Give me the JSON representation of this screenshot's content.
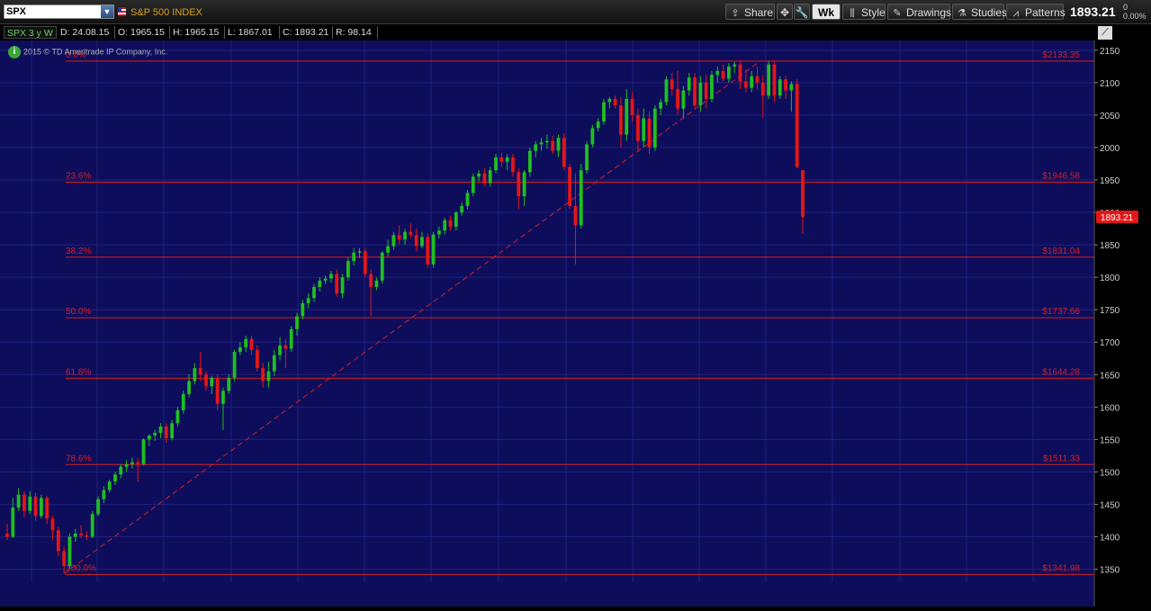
{
  "header": {
    "symbol": "SPX",
    "description": "S&P 500 INDEX",
    "last_price": "1893.21",
    "change_abs": "0",
    "change_pct": "0.00%",
    "buttons": {
      "share": "Share",
      "wk": "Wk",
      "style": "Style",
      "drawings": "Drawings",
      "studies": "Studies",
      "patterns": "Patterns"
    }
  },
  "infobar": {
    "chart_symbol": "SPX 3 y W",
    "date": "D: 24.08.15",
    "open": "O: 1965.15",
    "high": "H: 1965.15",
    "low": "L: 1867.01",
    "close": "C: 1893.21",
    "range": "R: 98.14"
  },
  "copyright": "2015 © TD Ameritrade IP Company, Inc.",
  "colors": {
    "background": "#0d0d5c",
    "up": "#1fbf1f",
    "down": "#e51616",
    "fib_line": "#d42020",
    "grid": "#202080",
    "price_marker": "#e51616"
  },
  "chart_data": {
    "type": "candlestick",
    "symbol": "SPX",
    "interval": "weekly",
    "span": "3 years",
    "ylim": [
      1330,
      2165
    ],
    "y_ticks": [
      1350,
      1400,
      1450,
      1500,
      1550,
      1600,
      1650,
      1700,
      1750,
      1800,
      1850,
      1900,
      1950,
      2000,
      2050,
      2100,
      2150
    ],
    "last_price_label": "1893.21",
    "fibonacci": [
      {
        "pct": "0.0%",
        "price": 2133.35,
        "price_label": "$2133.35"
      },
      {
        "pct": "23.6%",
        "price": 1946.58,
        "price_label": "$1946.58"
      },
      {
        "pct": "38.2%",
        "price": 1831.04,
        "price_label": "$1831.04"
      },
      {
        "pct": "50.0%",
        "price": 1737.66,
        "price_label": "$1737.66"
      },
      {
        "pct": "61.8%",
        "price": 1644.28,
        "price_label": "$1644.28"
      },
      {
        "pct": "78.6%",
        "price": 1511.33,
        "price_label": "$1511.33"
      },
      {
        "pct": "100.0%",
        "price": 1341.98,
        "price_label": "$1341.98"
      }
    ],
    "trendline": [
      {
        "index": 10,
        "price": 1343
      },
      {
        "index": 132,
        "price": 2130
      }
    ],
    "candles": [
      {
        "o": 1405,
        "h": 1420,
        "l": 1395,
        "c": 1400
      },
      {
        "o": 1400,
        "h": 1460,
        "l": 1398,
        "c": 1445
      },
      {
        "o": 1445,
        "h": 1475,
        "l": 1440,
        "c": 1465
      },
      {
        "o": 1465,
        "h": 1470,
        "l": 1430,
        "c": 1440
      },
      {
        "o": 1440,
        "h": 1470,
        "l": 1435,
        "c": 1462
      },
      {
        "o": 1462,
        "h": 1468,
        "l": 1425,
        "c": 1432
      },
      {
        "o": 1432,
        "h": 1465,
        "l": 1428,
        "c": 1460
      },
      {
        "o": 1460,
        "h": 1463,
        "l": 1420,
        "c": 1428
      },
      {
        "o": 1428,
        "h": 1432,
        "l": 1395,
        "c": 1410
      },
      {
        "o": 1410,
        "h": 1415,
        "l": 1370,
        "c": 1378
      },
      {
        "o": 1378,
        "h": 1385,
        "l": 1343,
        "c": 1355
      },
      {
        "o": 1355,
        "h": 1405,
        "l": 1350,
        "c": 1400
      },
      {
        "o": 1400,
        "h": 1412,
        "l": 1392,
        "c": 1405
      },
      {
        "o": 1405,
        "h": 1418,
        "l": 1398,
        "c": 1402
      },
      {
        "o": 1402,
        "h": 1408,
        "l": 1395,
        "c": 1400
      },
      {
        "o": 1400,
        "h": 1440,
        "l": 1398,
        "c": 1435
      },
      {
        "o": 1435,
        "h": 1462,
        "l": 1432,
        "c": 1458
      },
      {
        "o": 1458,
        "h": 1478,
        "l": 1452,
        "c": 1472
      },
      {
        "o": 1472,
        "h": 1488,
        "l": 1468,
        "c": 1485
      },
      {
        "o": 1485,
        "h": 1500,
        "l": 1480,
        "c": 1496
      },
      {
        "o": 1496,
        "h": 1512,
        "l": 1490,
        "c": 1508
      },
      {
        "o": 1508,
        "h": 1518,
        "l": 1500,
        "c": 1512
      },
      {
        "o": 1512,
        "h": 1522,
        "l": 1505,
        "c": 1515
      },
      {
        "o": 1515,
        "h": 1522,
        "l": 1485,
        "c": 1512
      },
      {
        "o": 1512,
        "h": 1552,
        "l": 1510,
        "c": 1550
      },
      {
        "o": 1550,
        "h": 1558,
        "l": 1540,
        "c": 1556
      },
      {
        "o": 1556,
        "h": 1565,
        "l": 1548,
        "c": 1560
      },
      {
        "o": 1560,
        "h": 1575,
        "l": 1552,
        "c": 1570
      },
      {
        "o": 1570,
        "h": 1575,
        "l": 1545,
        "c": 1552
      },
      {
        "o": 1552,
        "h": 1580,
        "l": 1548,
        "c": 1575
      },
      {
        "o": 1575,
        "h": 1600,
        "l": 1570,
        "c": 1595
      },
      {
        "o": 1595,
        "h": 1625,
        "l": 1590,
        "c": 1620
      },
      {
        "o": 1620,
        "h": 1650,
        "l": 1615,
        "c": 1640
      },
      {
        "o": 1640,
        "h": 1668,
        "l": 1635,
        "c": 1660
      },
      {
        "o": 1660,
        "h": 1685,
        "l": 1640,
        "c": 1650
      },
      {
        "o": 1650,
        "h": 1655,
        "l": 1625,
        "c": 1632
      },
      {
        "o": 1632,
        "h": 1648,
        "l": 1620,
        "c": 1645
      },
      {
        "o": 1645,
        "h": 1650,
        "l": 1595,
        "c": 1605
      },
      {
        "o": 1605,
        "h": 1630,
        "l": 1565,
        "c": 1625
      },
      {
        "o": 1625,
        "h": 1650,
        "l": 1620,
        "c": 1645
      },
      {
        "o": 1645,
        "h": 1688,
        "l": 1640,
        "c": 1685
      },
      {
        "o": 1685,
        "h": 1700,
        "l": 1680,
        "c": 1692
      },
      {
        "o": 1692,
        "h": 1710,
        "l": 1685,
        "c": 1705
      },
      {
        "o": 1705,
        "h": 1710,
        "l": 1680,
        "c": 1688
      },
      {
        "o": 1688,
        "h": 1695,
        "l": 1655,
        "c": 1660
      },
      {
        "o": 1660,
        "h": 1668,
        "l": 1630,
        "c": 1640
      },
      {
        "o": 1640,
        "h": 1670,
        "l": 1630,
        "c": 1655
      },
      {
        "o": 1655,
        "h": 1688,
        "l": 1648,
        "c": 1680
      },
      {
        "o": 1680,
        "h": 1708,
        "l": 1672,
        "c": 1695
      },
      {
        "o": 1695,
        "h": 1705,
        "l": 1660,
        "c": 1690
      },
      {
        "o": 1690,
        "h": 1725,
        "l": 1685,
        "c": 1720
      },
      {
        "o": 1720,
        "h": 1745,
        "l": 1710,
        "c": 1740
      },
      {
        "o": 1740,
        "h": 1765,
        "l": 1735,
        "c": 1760
      },
      {
        "o": 1760,
        "h": 1775,
        "l": 1752,
        "c": 1768
      },
      {
        "o": 1768,
        "h": 1790,
        "l": 1762,
        "c": 1785
      },
      {
        "o": 1785,
        "h": 1800,
        "l": 1778,
        "c": 1795
      },
      {
        "o": 1795,
        "h": 1802,
        "l": 1790,
        "c": 1798
      },
      {
        "o": 1798,
        "h": 1810,
        "l": 1792,
        "c": 1805
      },
      {
        "o": 1805,
        "h": 1812,
        "l": 1770,
        "c": 1775
      },
      {
        "o": 1775,
        "h": 1805,
        "l": 1768,
        "c": 1800
      },
      {
        "o": 1800,
        "h": 1830,
        "l": 1795,
        "c": 1825
      },
      {
        "o": 1825,
        "h": 1845,
        "l": 1818,
        "c": 1838
      },
      {
        "o": 1838,
        "h": 1845,
        "l": 1830,
        "c": 1840
      },
      {
        "o": 1840,
        "h": 1845,
        "l": 1800,
        "c": 1805
      },
      {
        "o": 1805,
        "h": 1812,
        "l": 1740,
        "c": 1785
      },
      {
        "o": 1785,
        "h": 1800,
        "l": 1780,
        "c": 1795
      },
      {
        "o": 1795,
        "h": 1840,
        "l": 1790,
        "c": 1838
      },
      {
        "o": 1838,
        "h": 1858,
        "l": 1832,
        "c": 1848
      },
      {
        "o": 1848,
        "h": 1870,
        "l": 1842,
        "c": 1865
      },
      {
        "o": 1865,
        "h": 1880,
        "l": 1850,
        "c": 1858
      },
      {
        "o": 1858,
        "h": 1875,
        "l": 1850,
        "c": 1870
      },
      {
        "o": 1870,
        "h": 1883,
        "l": 1860,
        "c": 1865
      },
      {
        "o": 1865,
        "h": 1875,
        "l": 1840,
        "c": 1848
      },
      {
        "o": 1848,
        "h": 1870,
        "l": 1845,
        "c": 1862
      },
      {
        "o": 1862,
        "h": 1868,
        "l": 1815,
        "c": 1820
      },
      {
        "o": 1820,
        "h": 1870,
        "l": 1815,
        "c": 1866
      },
      {
        "o": 1866,
        "h": 1878,
        "l": 1860,
        "c": 1872
      },
      {
        "o": 1872,
        "h": 1892,
        "l": 1866,
        "c": 1888
      },
      {
        "o": 1888,
        "h": 1895,
        "l": 1872,
        "c": 1878
      },
      {
        "o": 1878,
        "h": 1902,
        "l": 1872,
        "c": 1900
      },
      {
        "o": 1900,
        "h": 1915,
        "l": 1895,
        "c": 1910
      },
      {
        "o": 1910,
        "h": 1935,
        "l": 1905,
        "c": 1930
      },
      {
        "o": 1930,
        "h": 1960,
        "l": 1925,
        "c": 1955
      },
      {
        "o": 1955,
        "h": 1965,
        "l": 1948,
        "c": 1960
      },
      {
        "o": 1960,
        "h": 1968,
        "l": 1940,
        "c": 1945
      },
      {
        "o": 1945,
        "h": 1970,
        "l": 1940,
        "c": 1965
      },
      {
        "o": 1965,
        "h": 1990,
        "l": 1960,
        "c": 1985
      },
      {
        "o": 1985,
        "h": 1992,
        "l": 1970,
        "c": 1978
      },
      {
        "o": 1978,
        "h": 1990,
        "l": 1965,
        "c": 1985
      },
      {
        "o": 1985,
        "h": 1990,
        "l": 1955,
        "c": 1962
      },
      {
        "o": 1962,
        "h": 1968,
        "l": 1905,
        "c": 1925
      },
      {
        "o": 1925,
        "h": 1965,
        "l": 1910,
        "c": 1962
      },
      {
        "o": 1962,
        "h": 2000,
        "l": 1955,
        "c": 1995
      },
      {
        "o": 1995,
        "h": 2010,
        "l": 1985,
        "c": 2005
      },
      {
        "o": 2005,
        "h": 2015,
        "l": 1995,
        "c": 2008
      },
      {
        "o": 2008,
        "h": 2020,
        "l": 1998,
        "c": 2010
      },
      {
        "o": 2010,
        "h": 2018,
        "l": 1990,
        "c": 1995
      },
      {
        "o": 1995,
        "h": 2020,
        "l": 1985,
        "c": 2015
      },
      {
        "o": 2015,
        "h": 2022,
        "l": 1965,
        "c": 1970
      },
      {
        "o": 1970,
        "h": 1975,
        "l": 1905,
        "c": 1910
      },
      {
        "o": 1910,
        "h": 1960,
        "l": 1820,
        "c": 1880
      },
      {
        "o": 1880,
        "h": 1975,
        "l": 1875,
        "c": 1965
      },
      {
        "o": 1965,
        "h": 2010,
        "l": 1960,
        "c": 2005
      },
      {
        "o": 2005,
        "h": 2035,
        "l": 2000,
        "c": 2030
      },
      {
        "o": 2030,
        "h": 2045,
        "l": 2025,
        "c": 2040
      },
      {
        "o": 2040,
        "h": 2075,
        "l": 2035,
        "c": 2070
      },
      {
        "o": 2070,
        "h": 2078,
        "l": 2060,
        "c": 2075
      },
      {
        "o": 2075,
        "h": 2080,
        "l": 2060,
        "c": 2065
      },
      {
        "o": 2065,
        "h": 2078,
        "l": 2000,
        "c": 2020
      },
      {
        "o": 2020,
        "h": 2090,
        "l": 2010,
        "c": 2075
      },
      {
        "o": 2075,
        "h": 2085,
        "l": 2040,
        "c": 2050
      },
      {
        "o": 2050,
        "h": 2060,
        "l": 1995,
        "c": 2010
      },
      {
        "o": 2010,
        "h": 2060,
        "l": 2000,
        "c": 2045
      },
      {
        "o": 2045,
        "h": 2055,
        "l": 1990,
        "c": 2000
      },
      {
        "o": 2000,
        "h": 2065,
        "l": 1995,
        "c": 2060
      },
      {
        "o": 2060,
        "h": 2075,
        "l": 2050,
        "c": 2070
      },
      {
        "o": 2070,
        "h": 2110,
        "l": 2065,
        "c": 2105
      },
      {
        "o": 2105,
        "h": 2115,
        "l": 2080,
        "c": 2090
      },
      {
        "o": 2090,
        "h": 2118,
        "l": 2050,
        "c": 2060
      },
      {
        "o": 2060,
        "h": 2095,
        "l": 2045,
        "c": 2088
      },
      {
        "o": 2088,
        "h": 2115,
        "l": 2080,
        "c": 2108
      },
      {
        "o": 2108,
        "h": 2115,
        "l": 2060,
        "c": 2065
      },
      {
        "o": 2065,
        "h": 2110,
        "l": 2055,
        "c": 2100
      },
      {
        "o": 2100,
        "h": 2112,
        "l": 2060,
        "c": 2075
      },
      {
        "o": 2075,
        "h": 2118,
        "l": 2070,
        "c": 2112
      },
      {
        "o": 2112,
        "h": 2125,
        "l": 2100,
        "c": 2118
      },
      {
        "o": 2118,
        "h": 2128,
        "l": 2102,
        "c": 2106
      },
      {
        "o": 2106,
        "h": 2130,
        "l": 2100,
        "c": 2125
      },
      {
        "o": 2125,
        "h": 2132,
        "l": 2115,
        "c": 2128
      },
      {
        "o": 2128,
        "h": 2133,
        "l": 2090,
        "c": 2102
      },
      {
        "o": 2102,
        "h": 2120,
        "l": 2085,
        "c": 2092
      },
      {
        "o": 2092,
        "h": 2118,
        "l": 2085,
        "c": 2110
      },
      {
        "o": 2110,
        "h": 2125,
        "l": 2090,
        "c": 2100
      },
      {
        "o": 2100,
        "h": 2112,
        "l": 2045,
        "c": 2080
      },
      {
        "o": 2080,
        "h": 2133,
        "l": 2075,
        "c": 2128
      },
      {
        "o": 2128,
        "h": 2133,
        "l": 2070,
        "c": 2080
      },
      {
        "o": 2080,
        "h": 2110,
        "l": 2075,
        "c": 2105
      },
      {
        "o": 2105,
        "h": 2110,
        "l": 2075,
        "c": 2088
      },
      {
        "o": 2088,
        "h": 2102,
        "l": 2055,
        "c": 2098
      },
      {
        "o": 2098,
        "h": 2105,
        "l": 1968,
        "c": 1970
      },
      {
        "o": 1965,
        "h": 1965,
        "l": 1867,
        "c": 1893
      }
    ]
  }
}
